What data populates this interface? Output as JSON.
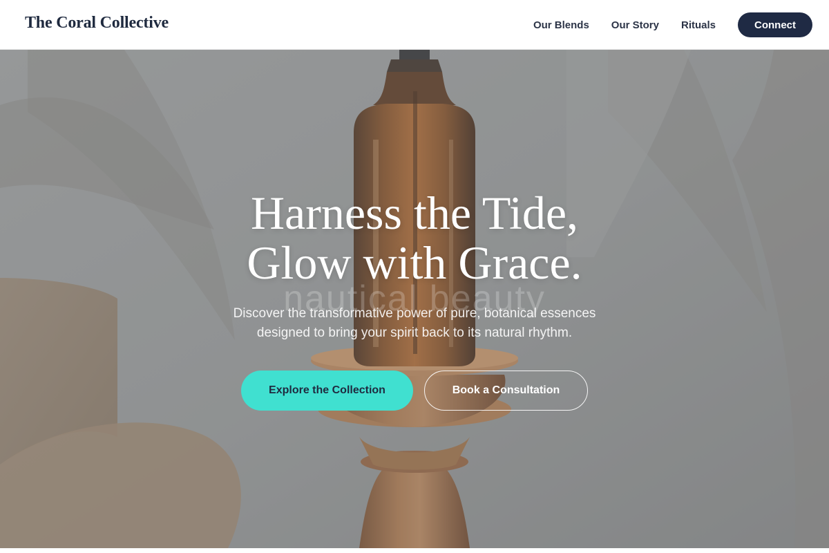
{
  "header": {
    "logo": "The Coral Collective",
    "nav": [
      {
        "label": "Our Blends"
      },
      {
        "label": "Our Story"
      },
      {
        "label": "Rituals"
      }
    ],
    "cta_label": "Connect"
  },
  "hero": {
    "headline_line1": "Harness the Tide,",
    "headline_line2": "Glow with Grace.",
    "watermark": "nautical beauty",
    "subtext_line1": "Discover the transformative power of pure, botanical essences",
    "subtext_line2": "designed to bring your spirit back to its natural rhythm.",
    "primary_button": "Explore the Collection",
    "secondary_button": "Book a Consultation"
  },
  "colors": {
    "brand_dark": "#1f2a44",
    "accent_teal": "#40e0d0",
    "hero_bg": "#8e8f8c"
  }
}
